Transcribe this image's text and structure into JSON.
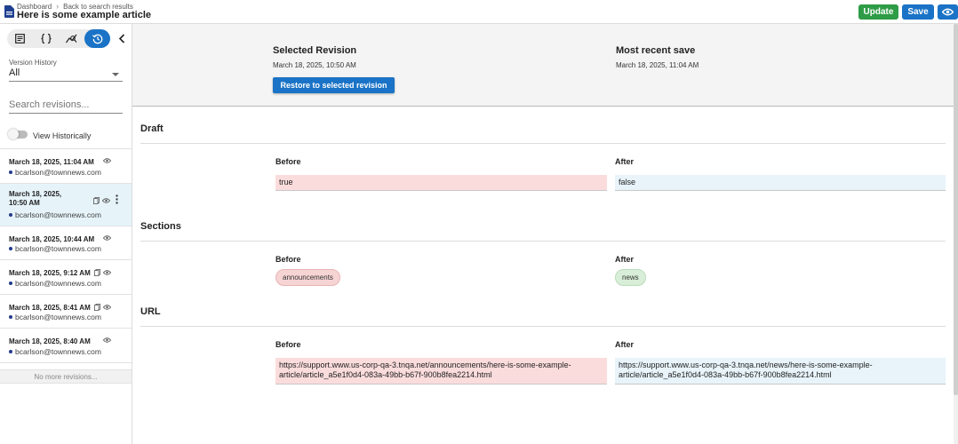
{
  "header": {
    "breadcrumbs": [
      "Dashboard",
      "Back to search results"
    ],
    "title": "Here is some example article",
    "update_label": "Update",
    "save_label": "Save",
    "colors": {
      "update": "#2e9c46",
      "save": "#1a73c6"
    }
  },
  "sidebar": {
    "tabs": [
      "details-icon",
      "code-braces-icon",
      "analytics-icon",
      "history-icon"
    ],
    "active_tab": "history-icon",
    "version_history_label": "Version History",
    "version_history_value": "All",
    "search_placeholder": "Search revisions...",
    "view_historically_label": "View Historically",
    "revisions": [
      {
        "date": "March 18, 2025, 11:04 AM",
        "user": "bcarlson@townnews.com"
      },
      {
        "date": "March 18, 2025, 10:50 AM",
        "user": "bcarlson@townnews.com"
      },
      {
        "date": "March 18, 2025, 10:44 AM",
        "user": "bcarlson@townnews.com"
      },
      {
        "date": "March 18, 2025, 9:12 AM",
        "user": "bcarlson@townnews.com"
      },
      {
        "date": "March 18, 2025, 8:41 AM",
        "user": "bcarlson@townnews.com"
      },
      {
        "date": "March 18, 2025, 8:40 AM",
        "user": "bcarlson@townnews.com"
      }
    ],
    "no_more_label": "No more revisions..."
  },
  "comparison": {
    "selected_title": "Selected Revision",
    "selected_date": "March 18, 2025, 10:50 AM",
    "recent_title": "Most recent save",
    "recent_date": "March 18, 2025, 11:04 AM",
    "restore_label": "Restore to selected revision"
  },
  "diff_sections": {
    "draft": {
      "title": "Draft",
      "before_label": "Before",
      "after_label": "After",
      "before": "true",
      "after": "false"
    },
    "sections": {
      "title": "Sections",
      "before_label": "Before",
      "after_label": "After",
      "before": "announcements",
      "after": "news"
    },
    "url": {
      "title": "URL",
      "before_label": "Before",
      "after_label": "After",
      "before": "https://support.www.us-corp-qa-3.tnqa.net/announcements/here-is-some-example-article/article_a5e1f0d4-083a-49bb-b67f-900b8fea2214.html",
      "after": "https://support.www.us-corp-qa-3.tnqa.net/news/here-is-some-example-article/article_a5e1f0d4-083a-49bb-b67f-900b8fea2214.html"
    }
  }
}
